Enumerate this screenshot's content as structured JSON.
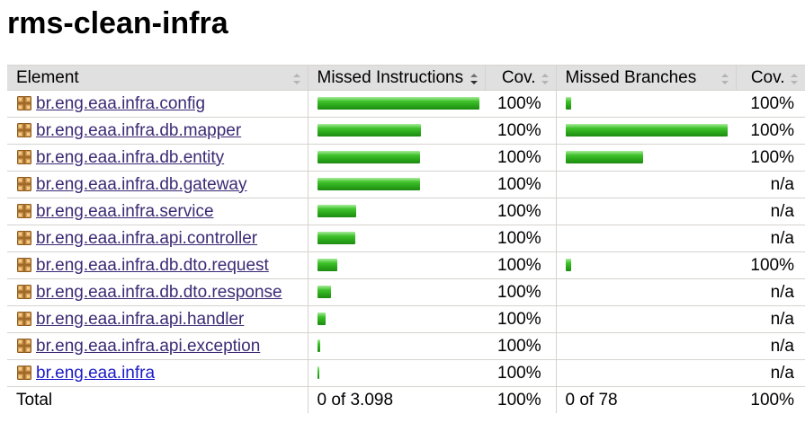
{
  "page": {
    "title": "rms-clean-infra"
  },
  "table": {
    "headers": {
      "element": "Element",
      "missed_instructions": "Missed Instructions",
      "cov1": "Cov.",
      "missed_branches": "Missed Branches",
      "cov2": "Cov."
    },
    "rows": [
      {
        "name": "br.eng.eaa.infra.config",
        "instr_bar": 1.0,
        "instr_cov": "100%",
        "branch_bar": 0.033,
        "branch_cov": "100%"
      },
      {
        "name": "br.eng.eaa.infra.db.mapper",
        "instr_bar": 0.64,
        "instr_cov": "100%",
        "branch_bar": 1.0,
        "branch_cov": "100%"
      },
      {
        "name": "br.eng.eaa.infra.db.entity",
        "instr_bar": 0.635,
        "instr_cov": "100%",
        "branch_bar": 0.48,
        "branch_cov": "100%"
      },
      {
        "name": "br.eng.eaa.infra.db.gateway",
        "instr_bar": 0.635,
        "instr_cov": "100%",
        "branch_bar": 0,
        "branch_cov": "n/a"
      },
      {
        "name": "br.eng.eaa.infra.service",
        "instr_bar": 0.24,
        "instr_cov": "100%",
        "branch_bar": 0,
        "branch_cov": "n/a"
      },
      {
        "name": "br.eng.eaa.infra.api.controller",
        "instr_bar": 0.235,
        "instr_cov": "100%",
        "branch_bar": 0,
        "branch_cov": "n/a"
      },
      {
        "name": "br.eng.eaa.infra.db.dto.request",
        "instr_bar": 0.12,
        "instr_cov": "100%",
        "branch_bar": 0.033,
        "branch_cov": "100%"
      },
      {
        "name": "br.eng.eaa.infra.db.dto.response",
        "instr_bar": 0.085,
        "instr_cov": "100%",
        "branch_bar": 0,
        "branch_cov": "n/a"
      },
      {
        "name": "br.eng.eaa.infra.api.handler",
        "instr_bar": 0.05,
        "instr_cov": "100%",
        "branch_bar": 0,
        "branch_cov": "n/a"
      },
      {
        "name": "br.eng.eaa.infra.api.exception",
        "instr_bar": 0.017,
        "instr_cov": "100%",
        "branch_bar": 0,
        "branch_cov": "n/a"
      },
      {
        "name": "br.eng.eaa.infra",
        "instr_bar": 0.011,
        "instr_cov": "100%",
        "branch_bar": 0,
        "branch_cov": "n/a",
        "unvisited": true
      }
    ],
    "total": {
      "label": "Total",
      "missed_instructions": "0 of 3.098",
      "instr_cov": "100%",
      "missed_branches": "0 of 78",
      "branch_cov": "100%"
    }
  },
  "icons": {
    "package": "package-icon",
    "sort": "sort-icon",
    "sort_desc": "sort-descending-icon"
  },
  "colors": {
    "header_bg": "#e0e0e0",
    "bar_green": "#2aa41a",
    "link": "#3c2a74",
    "link_unvisited": "#1a1ac8"
  }
}
